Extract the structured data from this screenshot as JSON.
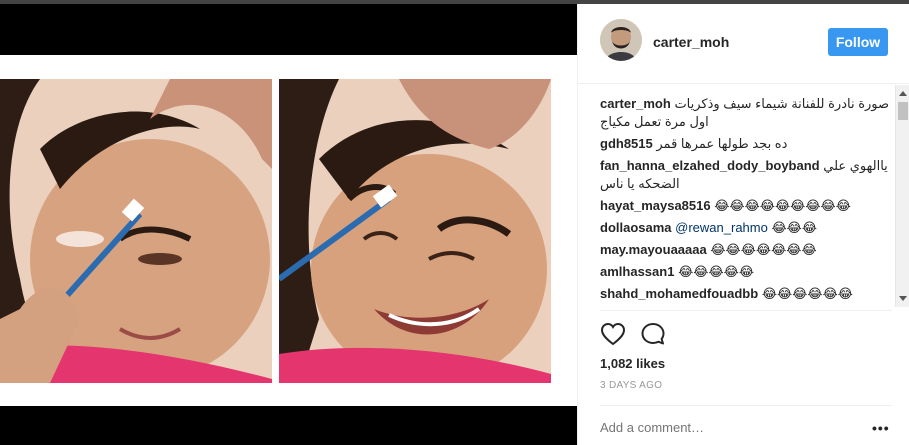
{
  "post": {
    "author": "carter_moh",
    "follow_label": "Follow",
    "caption": "صورة نادرة للفنانة شيماء سيف وذكريات اول مرة تعمل مكياج",
    "likes": "1,082 likes",
    "date": "3 DAYS AGO",
    "add_comment_placeholder": "Add a comment…",
    "more_label": "•••"
  },
  "comments": [
    {
      "user": "gdh8515",
      "text": "ده بجد طولها عمرها قمر"
    },
    {
      "user": "fan_hanna_elzahed_dody_boyband",
      "text": "ياالهوي علي الضحكه يا ناس"
    },
    {
      "user": "hayat_maysa8516",
      "text": "😂😂😂😂😂😂😂😂😂"
    },
    {
      "user": "dollaosama",
      "mention": "@rewan_rahmo",
      "text": "😂😂😂"
    },
    {
      "user": "may.mayouaaaaa",
      "text": "😂😂😂😂😂😂😂"
    },
    {
      "user": "amlhassan1",
      "text": "😂😂😂😂😂"
    },
    {
      "user": "shahd_mohamedfouadbb",
      "text": "😂😂😂😂😂😂"
    }
  ],
  "icons": {
    "like": "heart-icon",
    "comment": "comment-bubble-icon",
    "options": "more-options-icon"
  },
  "colors": {
    "follow_button": "#3897f0",
    "mention": "#003569",
    "secondary_text": "#999999"
  }
}
